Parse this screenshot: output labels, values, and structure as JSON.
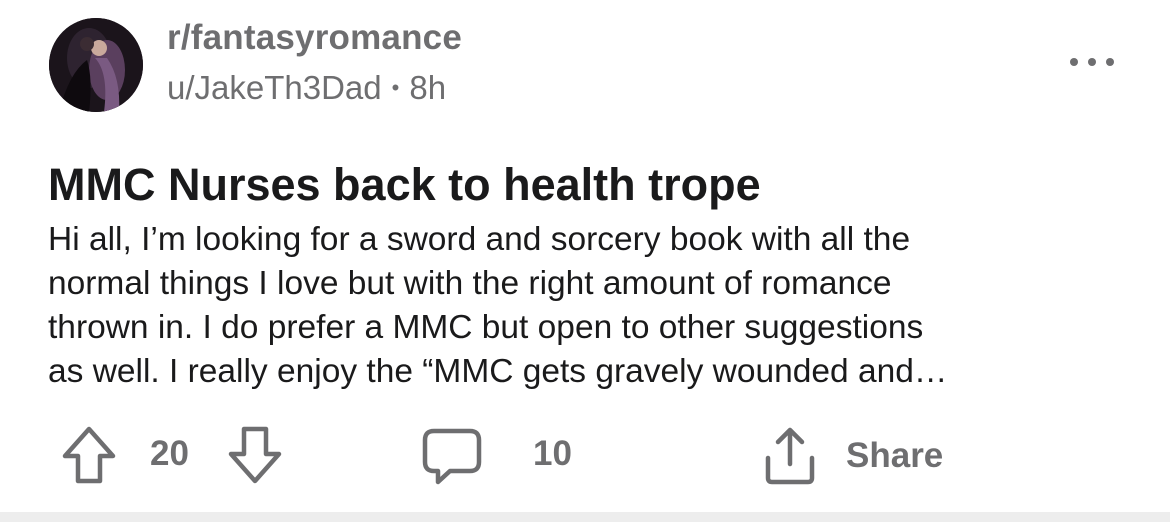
{
  "post": {
    "subreddit": "r/fantasyromance",
    "author": "u/JakeTh3Dad",
    "separator": "•",
    "time": "8h",
    "title": "MMC Nurses back to health trope",
    "body_lines": [
      "Hi all, I’m looking for a sword and sorcery book with all the",
      "normal things I love but with the right amount of romance",
      "thrown in. I do prefer a MMC but open to other suggestions",
      "as well. I really enjoy the “MMC gets gravely wounded and…"
    ]
  },
  "actions": {
    "vote_count": "20",
    "comment_count": "10",
    "share_label": "Share"
  },
  "icons": {
    "avatar": "subreddit-avatar",
    "more": "more-options-icon",
    "upvote": "upvote-arrow-icon",
    "downvote": "downvote-arrow-icon",
    "comment": "comment-bubble-icon",
    "share": "share-icon"
  },
  "colors": {
    "text_primary": "#1a1a1b",
    "text_secondary": "#6e6e70",
    "background": "#ffffff",
    "divider": "#ededed"
  }
}
